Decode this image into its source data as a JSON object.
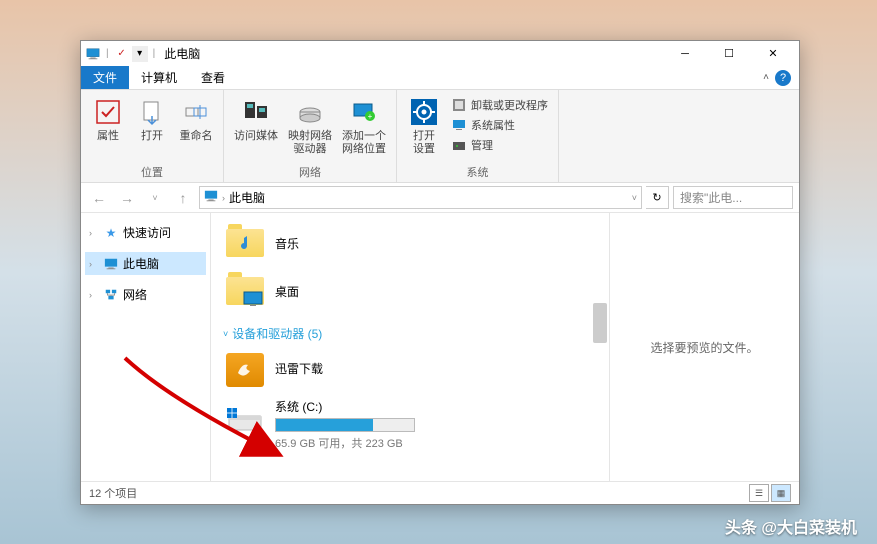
{
  "title": "此电脑",
  "tabs": {
    "file": "文件",
    "computer": "计算机",
    "view": "查看"
  },
  "ribbon": {
    "location": {
      "name": "位置",
      "properties": "属性",
      "open": "打开",
      "rename": "重命名"
    },
    "network": {
      "name": "网络",
      "media": "访问媒体",
      "map_drive": "映射网络\n驱动器",
      "add_location": "添加一个\n网络位置"
    },
    "system": {
      "name": "系统",
      "settings": "打开\n设置",
      "uninstall": "卸载或更改程序",
      "sys_properties": "系统属性",
      "manage": "管理"
    }
  },
  "nav": {
    "back": "←",
    "forward": "→",
    "up": "↑",
    "breadcrumb_root": "此电脑",
    "search_placeholder": "搜索\"此电..."
  },
  "navpane": {
    "quick_access": "快速访问",
    "this_pc": "此电脑",
    "network": "网络"
  },
  "items": {
    "music": "音乐",
    "desktop": "桌面"
  },
  "devices_section": "设备和驱动器 (5)",
  "xunlei": "迅雷下载",
  "drive_c": {
    "label": "系统 (C:)",
    "capacity_text": "65.9 GB 可用，共 223 GB",
    "fill_percent": 70
  },
  "preview_text": "选择要预览的文件。",
  "status": "12 个项目",
  "watermark": "头条 @大白菜装机"
}
